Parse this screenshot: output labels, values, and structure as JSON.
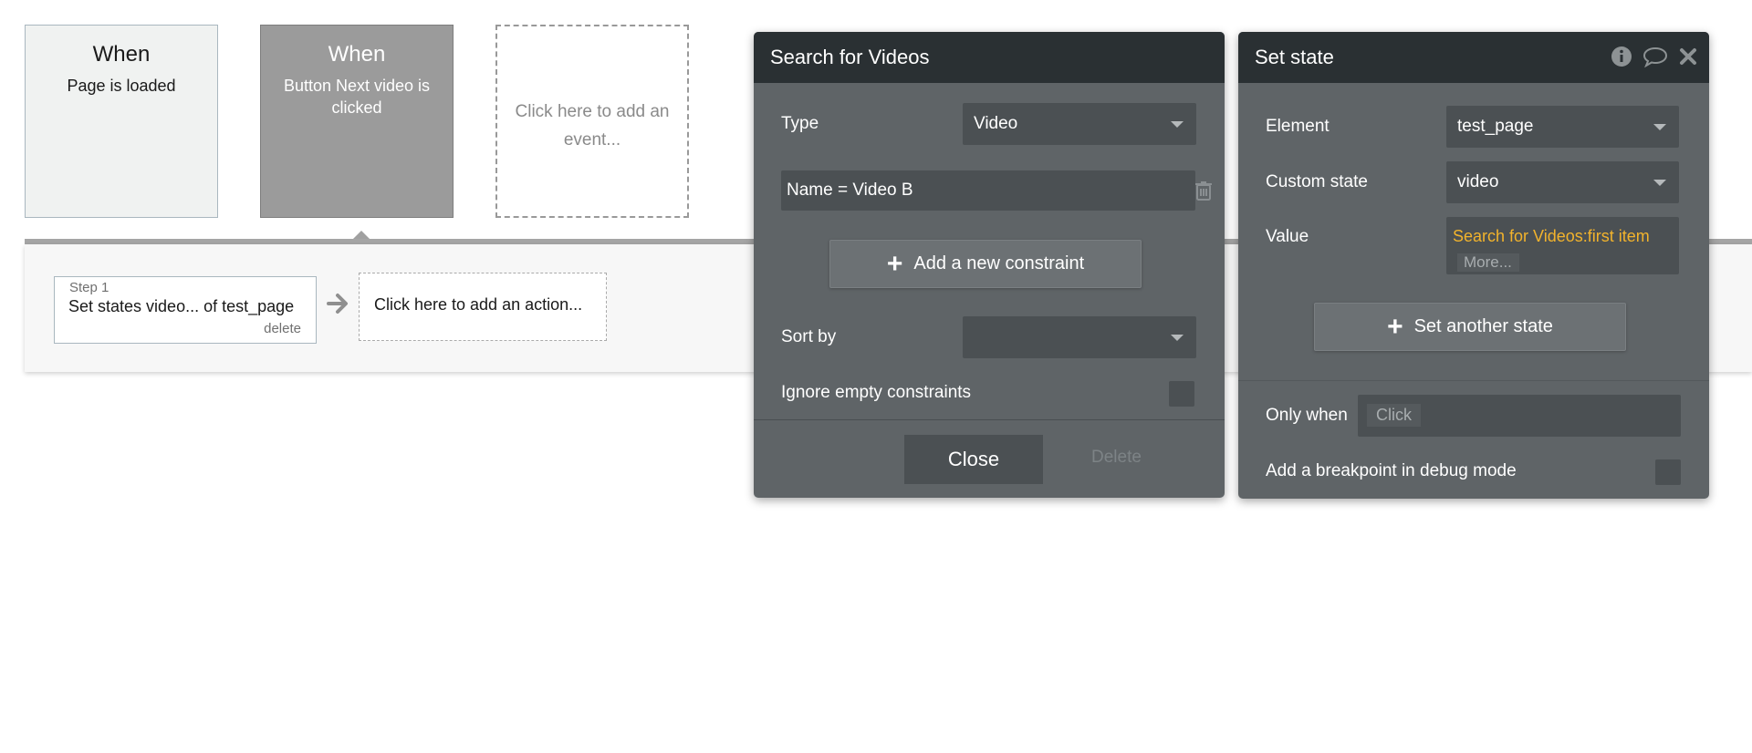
{
  "events": [
    {
      "title": "When",
      "subtitle": "Page is loaded"
    },
    {
      "title": "When",
      "subtitle": "Button Next video is clicked"
    },
    {
      "add_label": "Click here to add an event..."
    }
  ],
  "workflow": {
    "step_number": "Step 1",
    "step_text": "Set states video... of test_page",
    "step_delete": "delete",
    "add_action": "Click here to add an action..."
  },
  "search_panel": {
    "title": "Search for Videos",
    "type_label": "Type",
    "type_value": "Video",
    "constraint": "Name =  Video B",
    "add_constraint": "Add a new constraint",
    "sort_label": "Sort by",
    "sort_value": "",
    "ignore_label": "Ignore empty constraints",
    "close": "Close",
    "delete": "Delete"
  },
  "set_state_panel": {
    "title": "Set state",
    "element_label": "Element",
    "element_value": "test_page",
    "custom_state_label": "Custom state",
    "custom_state_value": "video",
    "value_label": "Value",
    "value_expr": "Search for Videos:first item",
    "value_more": "More...",
    "set_another": "Set another state",
    "only_when_label": "Only when",
    "only_when_value": "Click",
    "breakpoint_label": "Add a breakpoint in debug mode"
  },
  "colors": {
    "panel_bg": "#5f6467",
    "panel_header": "#2a3033",
    "field_bg": "#4b5053",
    "expression": "#f2b32c"
  },
  "icons": [
    "arrow-right-icon",
    "plus-icon",
    "trash-icon",
    "info-icon",
    "comment-icon",
    "close-icon",
    "chevron-down-icon"
  ]
}
